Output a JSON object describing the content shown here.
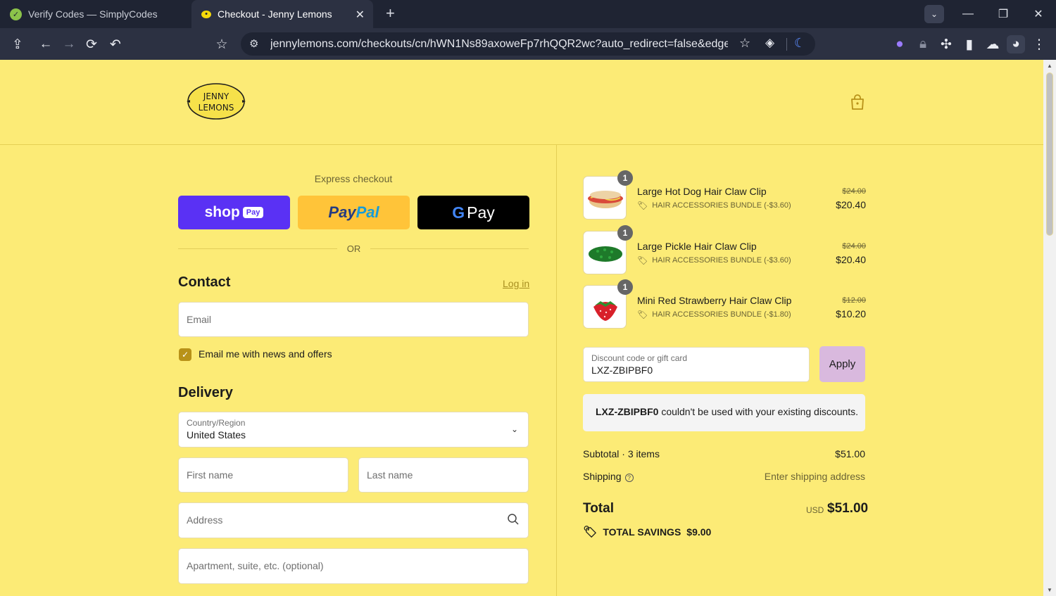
{
  "browser": {
    "tabs": [
      {
        "title": "Verify Codes — SimplyCodes",
        "active": false
      },
      {
        "title": "Checkout - Jenny Lemons",
        "active": true
      }
    ],
    "url": "jennylemons.com/checkouts/cn/hWN1Ns89axoweFp7rhQQR2wc?auto_redirect=false&edge_r..."
  },
  "header": {
    "logo_text_line1": "JENNY",
    "logo_text_line2": "LEMONS"
  },
  "express": {
    "label": "Express checkout",
    "shop_label": "shop",
    "shop_pill": "Pay",
    "paypal_part1": "Pay",
    "paypal_part2": "Pal",
    "gpay_g": "G",
    "gpay_label": "Pay",
    "or_label": "OR"
  },
  "contact": {
    "title": "Contact",
    "login_link": "Log in",
    "email_placeholder": "Email",
    "newsletter_label": "Email me with news and offers",
    "newsletter_checked": true
  },
  "delivery": {
    "title": "Delivery",
    "country_label": "Country/Region",
    "country_value": "United States",
    "first_name_placeholder": "First name",
    "last_name_placeholder": "Last name",
    "address_placeholder": "Address",
    "apartment_placeholder": "Apartment, suite, etc. (optional)"
  },
  "cart": {
    "items": [
      {
        "qty": "1",
        "name": "Large Hot Dog Hair Claw Clip",
        "discount": "HAIR ACCESSORIES BUNDLE (-$3.60)",
        "old_price": "$24.00",
        "price": "$20.40",
        "image": "hot-dog"
      },
      {
        "qty": "1",
        "name": "Large Pickle Hair Claw Clip",
        "discount": "HAIR ACCESSORIES BUNDLE (-$3.60)",
        "old_price": "$24.00",
        "price": "$20.40",
        "image": "pickle"
      },
      {
        "qty": "1",
        "name": "Mini Red Strawberry Hair Claw Clip",
        "discount": "HAIR ACCESSORIES BUNDLE (-$1.80)",
        "old_price": "$12.00",
        "price": "$10.20",
        "image": "strawberry"
      }
    ],
    "discount_label": "Discount code or gift card",
    "discount_value": "LXZ-ZBIPBF0",
    "apply_label": "Apply",
    "error_code": "LXZ-ZBIPBF0",
    "error_message": " couldn't be used with your existing discounts.",
    "subtotal_label": "Subtotal · 3 items",
    "subtotal_value": "$51.00",
    "shipping_label": "Shipping",
    "shipping_value": "Enter shipping address",
    "total_label": "Total",
    "total_currency": "USD",
    "total_value": "$51.00",
    "savings_label": "TOTAL SAVINGS",
    "savings_value": "$9.00"
  },
  "colors": {
    "page_bg": "#fceb76",
    "shop_pay": "#5a31f4",
    "paypal": "#ffc439",
    "apply_button": "#d9b9de",
    "checkbox": "#b89218"
  }
}
